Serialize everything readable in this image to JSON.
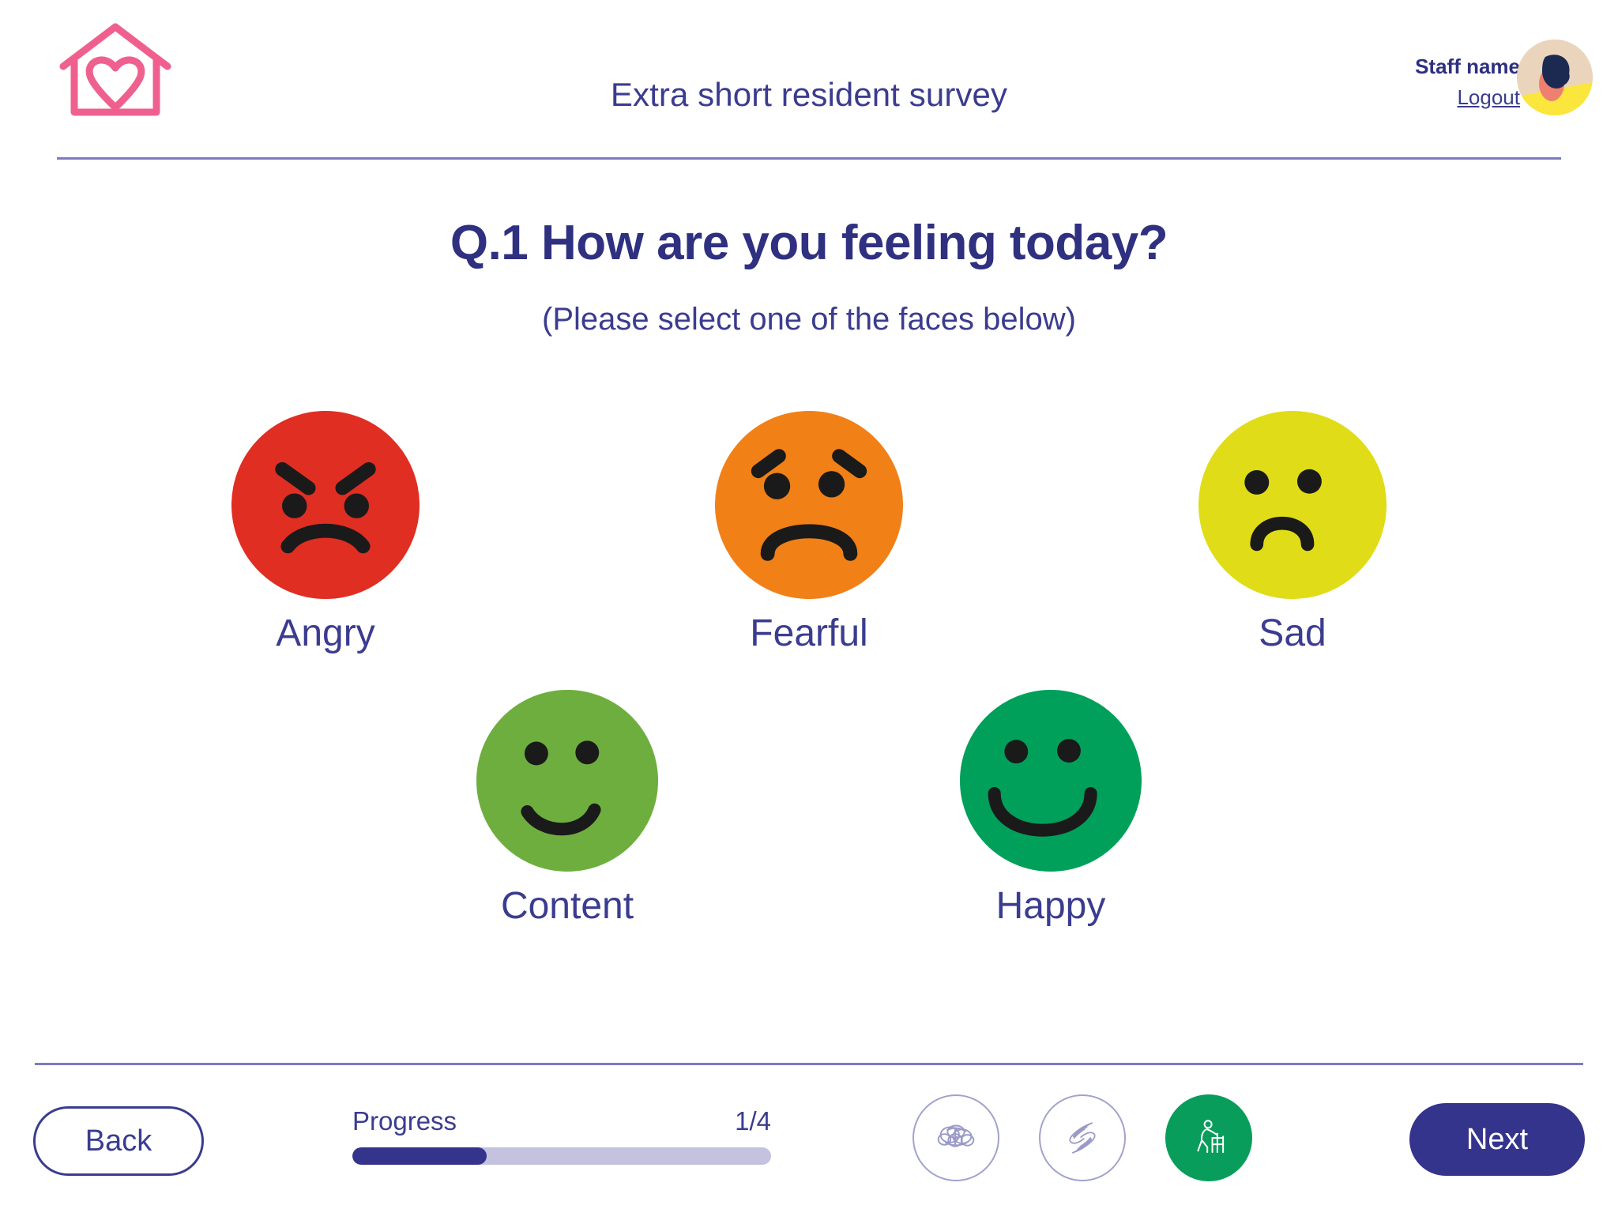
{
  "header": {
    "logo_icon": "house-heart-logo",
    "logo_color": "#F0608F",
    "title": "Extra short resident survey",
    "staff_name": "Staff name",
    "logout_label": "Logout",
    "avatar_icon": "user-avatar"
  },
  "question": {
    "title": "Q.1 How are you feeling today?",
    "subtitle": "(Please select one of the faces below)",
    "title_color": "#2F3080"
  },
  "faces": {
    "row1": [
      {
        "label": "Angry",
        "icon": "angry-face-icon",
        "color": "#E02E22",
        "selected": false
      },
      {
        "label": "Fearful",
        "icon": "fearful-face-icon",
        "color": "#F18017",
        "selected": false
      },
      {
        "label": "Sad",
        "icon": "sad-face-icon",
        "color": "#E0DC17",
        "selected": false
      }
    ],
    "row2": [
      {
        "label": "Content",
        "icon": "content-face-icon",
        "color": "#6EAE3E",
        "selected": false
      },
      {
        "label": "Happy",
        "icon": "happy-face-icon",
        "color": "#00A05A",
        "selected": false
      }
    ]
  },
  "footer": {
    "back_label": "Back",
    "next_label": "Next",
    "progress_label": "Progress",
    "progress_count": "1/4",
    "progress_percent": 32,
    "accent_color": "#35348C",
    "track_color": "#C3C3E0",
    "category_icons": [
      {
        "icon": "brain-icon",
        "active": false
      },
      {
        "icon": "caring-hands-icon",
        "active": false
      },
      {
        "icon": "walking-frame-icon",
        "active": true,
        "active_color": "#089D5B"
      }
    ]
  }
}
